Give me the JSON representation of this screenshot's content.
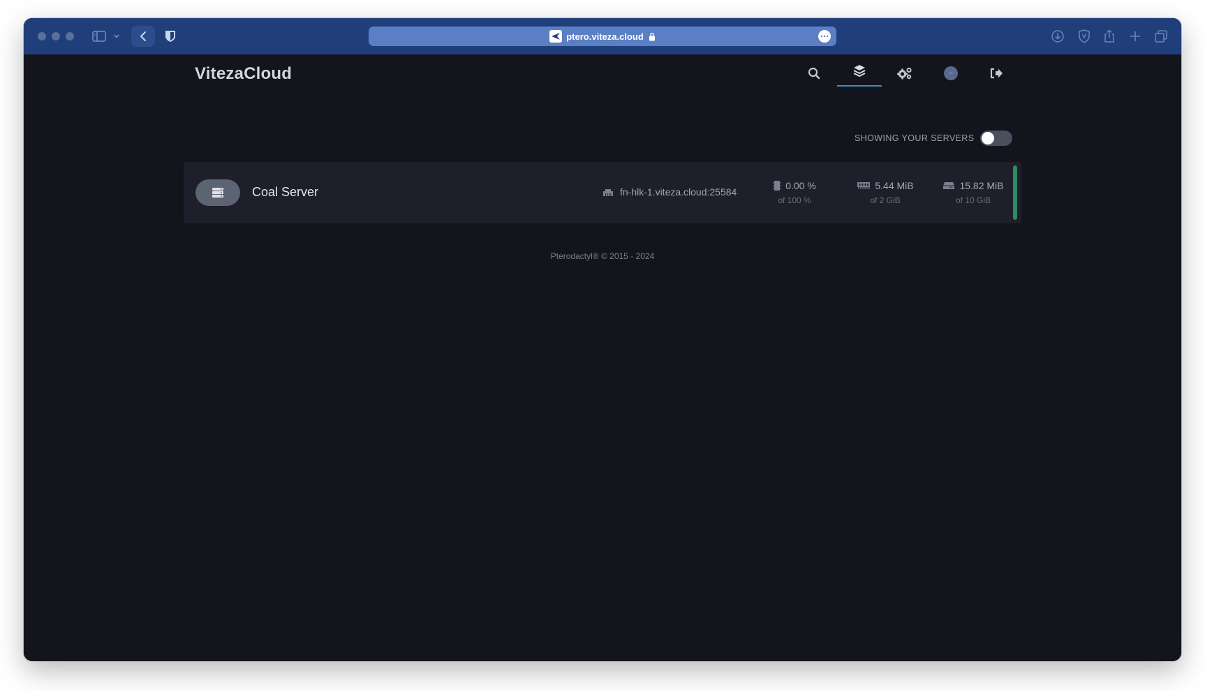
{
  "browser": {
    "url": "ptero.viteza.cloud"
  },
  "nav": {
    "brand": "VitezaCloud"
  },
  "servers_filter": {
    "label": "SHOWING YOUR SERVERS",
    "enabled": false
  },
  "server": {
    "name": "Coal Server",
    "allocation": "fn-hlk-1.viteza.cloud:25584",
    "cpu": {
      "value": "0.00 %",
      "limit": "of 100 %"
    },
    "memory": {
      "value": "5.44 MiB",
      "limit": "of 2 GiB"
    },
    "disk": {
      "value": "15.82 MiB",
      "limit": "of 10 GiB"
    },
    "status_color": "#2e8a63"
  },
  "footer": {
    "text": "Pterodactyl® © 2015 - 2024"
  },
  "colors": {
    "titlebar": "#1f3e7a",
    "page_bg": "#13141c",
    "card_bg": "#1e1f2b",
    "accent": "#3f8dc9"
  }
}
